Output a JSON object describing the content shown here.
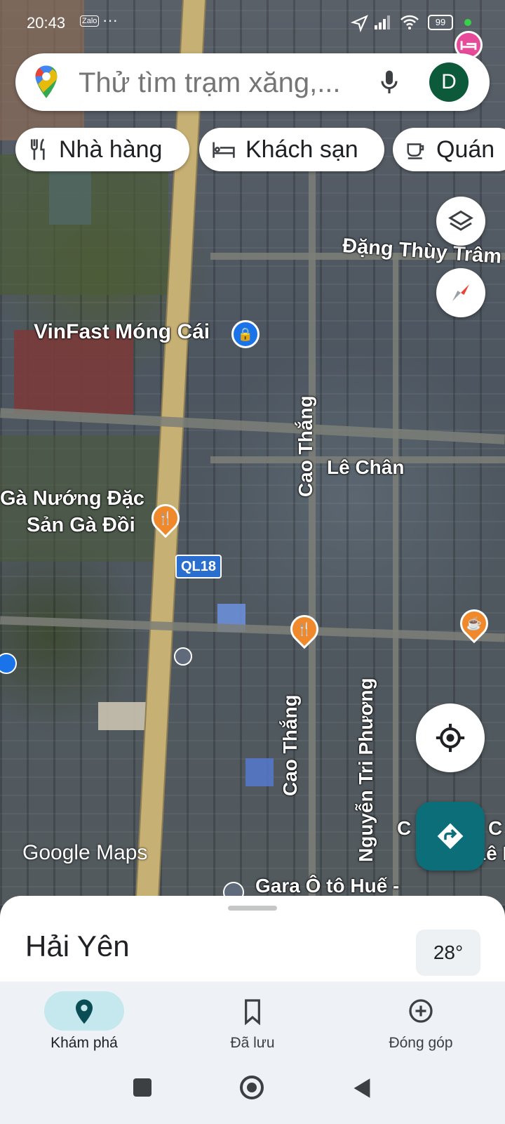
{
  "status_bar": {
    "time": "20:43",
    "app_icon": "Zalo",
    "more": "···",
    "battery": "99"
  },
  "search": {
    "placeholder": "Thử tìm trạm xăng,...",
    "avatar_letter": "D"
  },
  "chips": [
    {
      "label": "Nhà hàng",
      "icon": "fork-knife-icon"
    },
    {
      "label": "Khách sạn",
      "icon": "bed-icon"
    },
    {
      "label": "Quán",
      "icon": "coffee-cup-icon"
    }
  ],
  "map": {
    "labels": {
      "dang_thuy_tram": "Đặng Thùy Trâm",
      "vinfast": "VinFast Móng Cái",
      "cao_thang_1": "Cao Thắng",
      "le_chan": "Lê Chân",
      "ga_nuong_1": "Gà Nướng Đặc",
      "ga_nuong_2": "Sản Gà Đồi",
      "ql18": "QL18",
      "cao_thang_2": "Cao Thắng",
      "nguyen_tri_phuong": "Nguyễn Tri Phương",
      "gara": "Gara Ô tô Huế -",
      "c_partial": "C",
      "c_partial_2": "C",
      "le_partial": "Lê N",
      "watermark": "Google Maps"
    }
  },
  "sheet": {
    "place": "Hải Yên",
    "temperature": "28°"
  },
  "bottom_nav": [
    {
      "label": "Khám phá",
      "icon": "location-pin-icon",
      "active": true
    },
    {
      "label": "Đã lưu",
      "icon": "bookmark-icon",
      "active": false
    },
    {
      "label": "Đóng góp",
      "icon": "add-circle-icon",
      "active": false
    }
  ],
  "colors": {
    "accent": "#0b6e78",
    "active_pill": "#c4e8ee",
    "road_main": "#c7b074",
    "pin_orange": "#f0892b",
    "pin_blue": "#1a73e8"
  }
}
